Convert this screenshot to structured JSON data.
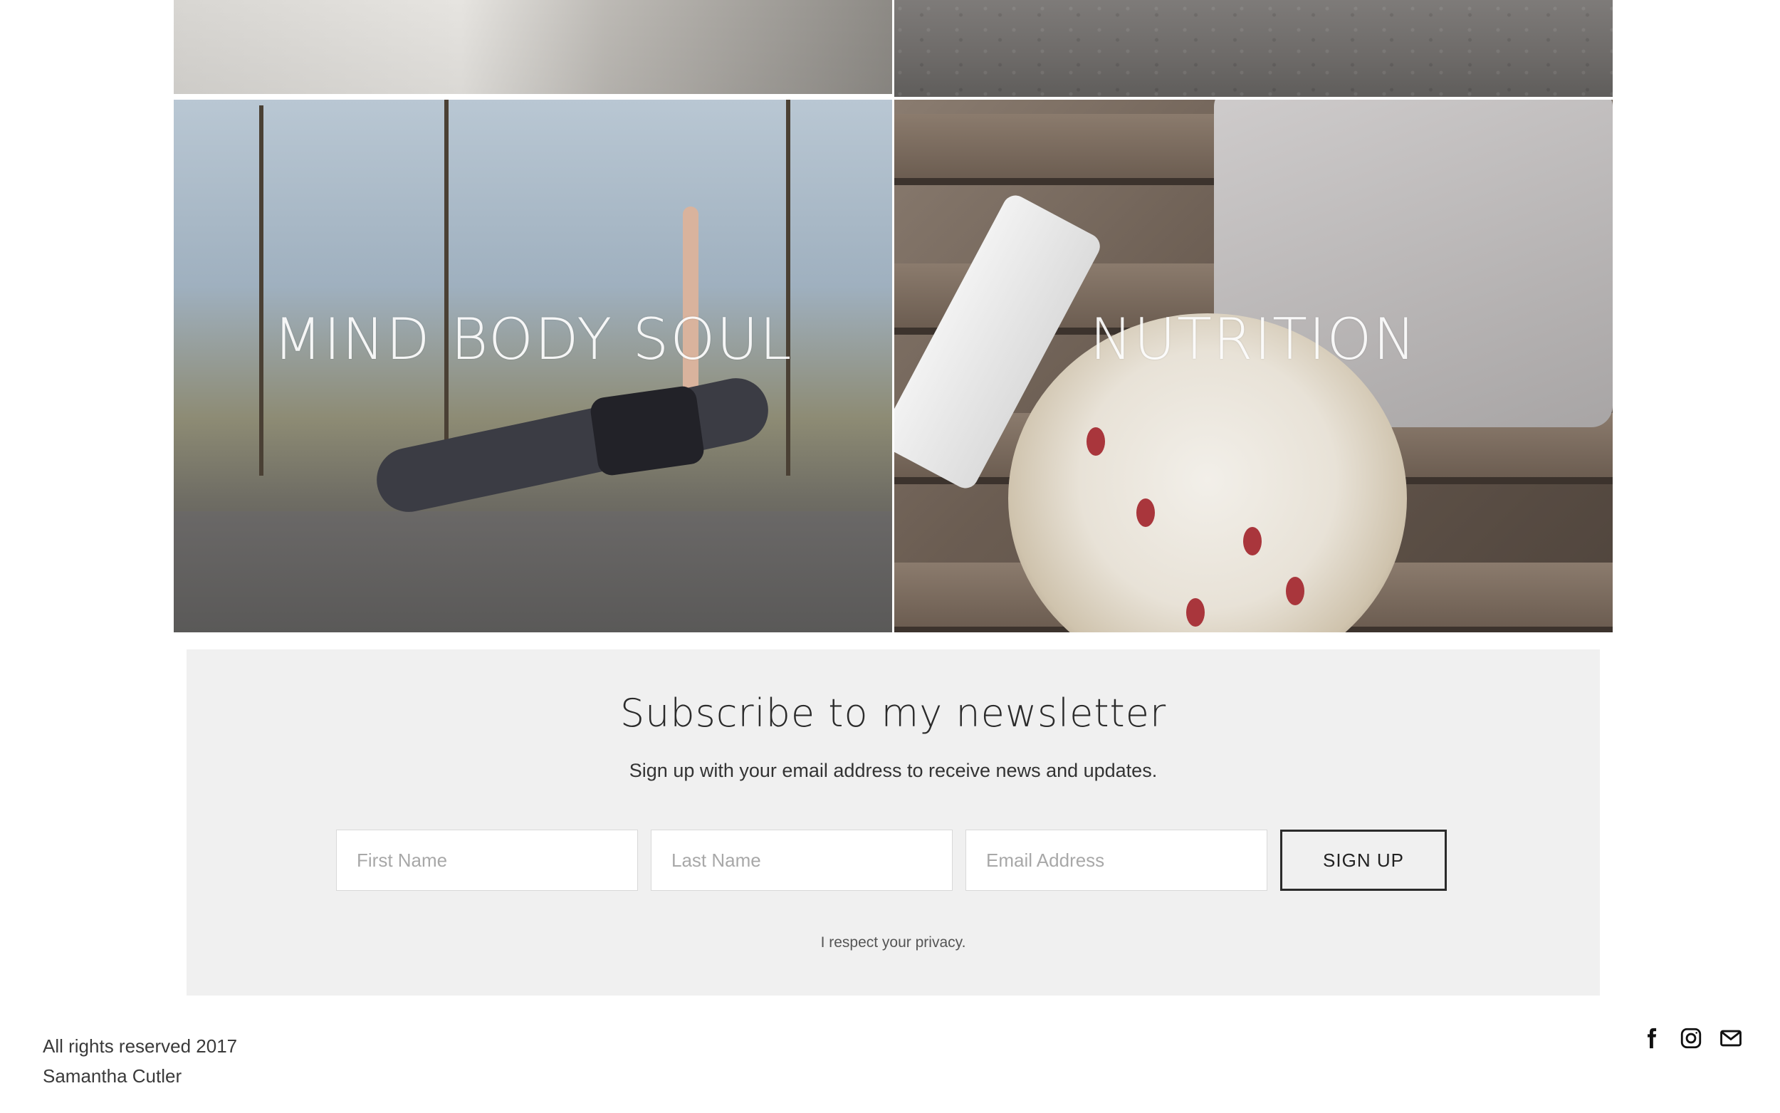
{
  "tiles": {
    "mind_body_soul": {
      "label": "MIND BODY SOUL"
    },
    "nutrition": {
      "label": "NUTRITION"
    }
  },
  "newsletter": {
    "title": "Subscribe to my newsletter",
    "subtitle": "Sign up with your email address to receive news and updates.",
    "first_name_placeholder": "First Name",
    "last_name_placeholder": "Last Name",
    "email_placeholder": "Email Address",
    "button_label": "SIGN UP",
    "privacy_note": "I respect your privacy."
  },
  "footer": {
    "line1": "All rights reserved 2017",
    "line2": "Samantha Cutler",
    "icons": [
      "facebook-icon",
      "instagram-icon",
      "email-icon"
    ]
  }
}
